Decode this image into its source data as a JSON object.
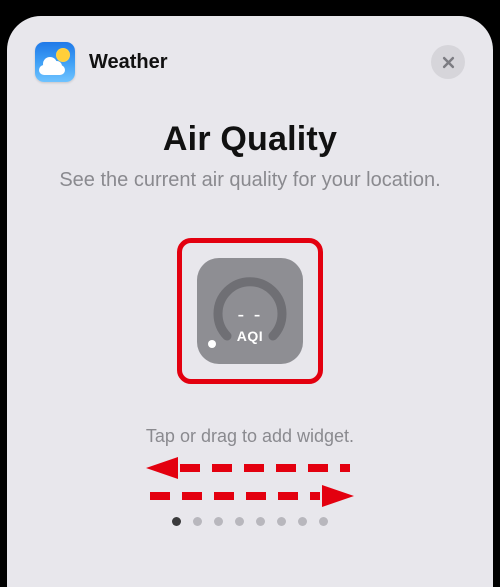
{
  "sheet": {
    "app_name": "Weather",
    "title": "Air Quality",
    "subtitle": "See the current air quality for your location.",
    "hint": "Tap or drag to add widget."
  },
  "widget": {
    "value": "- -",
    "label": "AQI"
  },
  "pager": {
    "count": 8,
    "active_index": 0
  },
  "colors": {
    "highlight": "#e3000f"
  }
}
